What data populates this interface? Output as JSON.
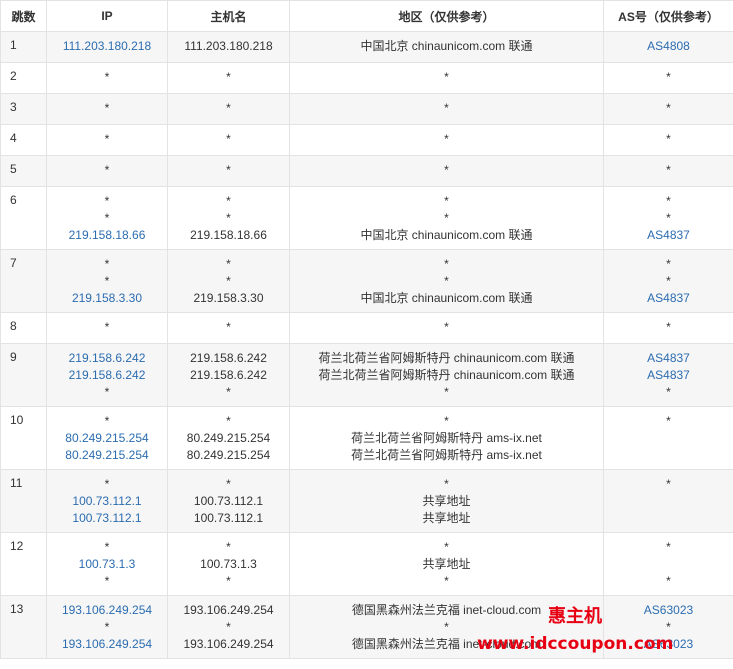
{
  "headers": {
    "hop": "跳数",
    "ip": "IP",
    "host": "主机名",
    "region": "地区（仅供参考）",
    "as": "AS号（仅供参考）"
  },
  "rows": [
    {
      "hop": "1",
      "ip": [
        {
          "text": "111.203.180.218",
          "link": true
        }
      ],
      "host": [
        {
          "text": "111.203.180.218"
        }
      ],
      "region": [
        {
          "text": "中国北京 chinaunicom.com 联通"
        }
      ],
      "as": [
        {
          "text": "AS4808",
          "link": true
        }
      ]
    },
    {
      "hop": "2",
      "ip": [
        {
          "text": "*"
        }
      ],
      "host": [
        {
          "text": "*"
        }
      ],
      "region": [
        {
          "text": "*"
        }
      ],
      "as": [
        {
          "text": "*"
        }
      ]
    },
    {
      "hop": "3",
      "ip": [
        {
          "text": "*"
        }
      ],
      "host": [
        {
          "text": "*"
        }
      ],
      "region": [
        {
          "text": "*"
        }
      ],
      "as": [
        {
          "text": "*"
        }
      ]
    },
    {
      "hop": "4",
      "ip": [
        {
          "text": "*"
        }
      ],
      "host": [
        {
          "text": "*"
        }
      ],
      "region": [
        {
          "text": "*"
        }
      ],
      "as": [
        {
          "text": "*"
        }
      ]
    },
    {
      "hop": "5",
      "ip": [
        {
          "text": "*"
        }
      ],
      "host": [
        {
          "text": "*"
        }
      ],
      "region": [
        {
          "text": "*"
        }
      ],
      "as": [
        {
          "text": "*"
        }
      ]
    },
    {
      "hop": "6",
      "ip": [
        {
          "text": "*"
        },
        {
          "text": "*"
        },
        {
          "text": "219.158.18.66",
          "link": true
        }
      ],
      "host": [
        {
          "text": "*"
        },
        {
          "text": "*"
        },
        {
          "text": "219.158.18.66"
        }
      ],
      "region": [
        {
          "text": "*"
        },
        {
          "text": "*"
        },
        {
          "text": "中国北京 chinaunicom.com 联通"
        }
      ],
      "as": [
        {
          "text": "*"
        },
        {
          "text": "*"
        },
        {
          "text": "AS4837",
          "link": true
        }
      ]
    },
    {
      "hop": "7",
      "ip": [
        {
          "text": "*"
        },
        {
          "text": "*"
        },
        {
          "text": "219.158.3.30",
          "link": true
        }
      ],
      "host": [
        {
          "text": "*"
        },
        {
          "text": "*"
        },
        {
          "text": "219.158.3.30"
        }
      ],
      "region": [
        {
          "text": "*"
        },
        {
          "text": "*"
        },
        {
          "text": "中国北京 chinaunicom.com 联通"
        }
      ],
      "as": [
        {
          "text": "*"
        },
        {
          "text": "*"
        },
        {
          "text": "AS4837",
          "link": true
        }
      ]
    },
    {
      "hop": "8",
      "ip": [
        {
          "text": "*"
        }
      ],
      "host": [
        {
          "text": "*"
        }
      ],
      "region": [
        {
          "text": "*"
        }
      ],
      "as": [
        {
          "text": "*"
        }
      ]
    },
    {
      "hop": "9",
      "ip": [
        {
          "text": "219.158.6.242",
          "link": true
        },
        {
          "text": "219.158.6.242",
          "link": true
        },
        {
          "text": "*"
        }
      ],
      "host": [
        {
          "text": "219.158.6.242"
        },
        {
          "text": "219.158.6.242"
        },
        {
          "text": "*"
        }
      ],
      "region": [
        {
          "text": "荷兰北荷兰省阿姆斯特丹 chinaunicom.com 联通"
        },
        {
          "text": "荷兰北荷兰省阿姆斯特丹 chinaunicom.com 联通"
        },
        {
          "text": "*"
        }
      ],
      "as": [
        {
          "text": "AS4837",
          "link": true
        },
        {
          "text": "AS4837",
          "link": true
        },
        {
          "text": "*"
        }
      ]
    },
    {
      "hop": "10",
      "ip": [
        {
          "text": "*"
        },
        {
          "text": "80.249.215.254",
          "link": true
        },
        {
          "text": "80.249.215.254",
          "link": true
        }
      ],
      "host": [
        {
          "text": "*"
        },
        {
          "text": "80.249.215.254"
        },
        {
          "text": "80.249.215.254"
        }
      ],
      "region": [
        {
          "text": "*"
        },
        {
          "text": "荷兰北荷兰省阿姆斯特丹 ams-ix.net"
        },
        {
          "text": "荷兰北荷兰省阿姆斯特丹 ams-ix.net"
        }
      ],
      "as": [
        {
          "text": "*"
        }
      ]
    },
    {
      "hop": "11",
      "ip": [
        {
          "text": "*"
        },
        {
          "text": "100.73.112.1",
          "link": true
        },
        {
          "text": "100.73.112.1",
          "link": true
        }
      ],
      "host": [
        {
          "text": "*"
        },
        {
          "text": "100.73.112.1"
        },
        {
          "text": "100.73.112.1"
        }
      ],
      "region": [
        {
          "text": "*"
        },
        {
          "text": "共享地址"
        },
        {
          "text": "共享地址"
        }
      ],
      "as": [
        {
          "text": "*"
        }
      ]
    },
    {
      "hop": "12",
      "ip": [
        {
          "text": "*"
        },
        {
          "text": "100.73.1.3",
          "link": true
        },
        {
          "text": "*"
        }
      ],
      "host": [
        {
          "text": "*"
        },
        {
          "text": "100.73.1.3"
        },
        {
          "text": "*"
        }
      ],
      "region": [
        {
          "text": "*"
        },
        {
          "text": "共享地址"
        },
        {
          "text": "*"
        }
      ],
      "as": [
        {
          "text": "*"
        },
        {
          "text": " "
        },
        {
          "text": "*"
        }
      ]
    },
    {
      "hop": "13",
      "ip": [
        {
          "text": "193.106.249.254",
          "link": true
        },
        {
          "text": "*"
        },
        {
          "text": "193.106.249.254",
          "link": true
        }
      ],
      "host": [
        {
          "text": "193.106.249.254"
        },
        {
          "text": "*"
        },
        {
          "text": "193.106.249.254"
        }
      ],
      "region": [
        {
          "text": "德国黑森州法兰克福 inet-cloud.com"
        },
        {
          "text": "*"
        },
        {
          "text": "德国黑森州法兰克福 inet-cloud.com"
        }
      ],
      "as": [
        {
          "text": "AS63023",
          "link": true
        },
        {
          "text": "*"
        },
        {
          "text": "AS63023",
          "link": true
        }
      ]
    }
  ],
  "watermark": {
    "title": "惠主机",
    "url": "www.idccoupon.com"
  },
  "colors": {
    "link": "#2b6cb0",
    "text": "#333333",
    "stripe": "#f6f6f6",
    "border": "#e3e3e3",
    "watermark": "#e60012"
  }
}
